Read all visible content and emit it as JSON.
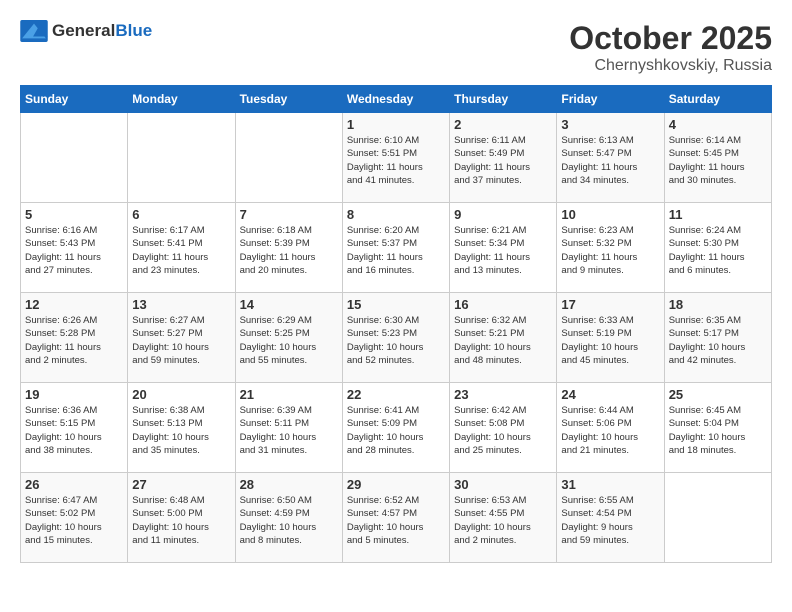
{
  "header": {
    "logo_general": "General",
    "logo_blue": "Blue",
    "month": "October 2025",
    "location": "Chernyshkovskiy, Russia"
  },
  "weekdays": [
    "Sunday",
    "Monday",
    "Tuesday",
    "Wednesday",
    "Thursday",
    "Friday",
    "Saturday"
  ],
  "weeks": [
    [
      {
        "day": "",
        "info": ""
      },
      {
        "day": "",
        "info": ""
      },
      {
        "day": "",
        "info": ""
      },
      {
        "day": "1",
        "info": "Sunrise: 6:10 AM\nSunset: 5:51 PM\nDaylight: 11 hours\nand 41 minutes."
      },
      {
        "day": "2",
        "info": "Sunrise: 6:11 AM\nSunset: 5:49 PM\nDaylight: 11 hours\nand 37 minutes."
      },
      {
        "day": "3",
        "info": "Sunrise: 6:13 AM\nSunset: 5:47 PM\nDaylight: 11 hours\nand 34 minutes."
      },
      {
        "day": "4",
        "info": "Sunrise: 6:14 AM\nSunset: 5:45 PM\nDaylight: 11 hours\nand 30 minutes."
      }
    ],
    [
      {
        "day": "5",
        "info": "Sunrise: 6:16 AM\nSunset: 5:43 PM\nDaylight: 11 hours\nand 27 minutes."
      },
      {
        "day": "6",
        "info": "Sunrise: 6:17 AM\nSunset: 5:41 PM\nDaylight: 11 hours\nand 23 minutes."
      },
      {
        "day": "7",
        "info": "Sunrise: 6:18 AM\nSunset: 5:39 PM\nDaylight: 11 hours\nand 20 minutes."
      },
      {
        "day": "8",
        "info": "Sunrise: 6:20 AM\nSunset: 5:37 PM\nDaylight: 11 hours\nand 16 minutes."
      },
      {
        "day": "9",
        "info": "Sunrise: 6:21 AM\nSunset: 5:34 PM\nDaylight: 11 hours\nand 13 minutes."
      },
      {
        "day": "10",
        "info": "Sunrise: 6:23 AM\nSunset: 5:32 PM\nDaylight: 11 hours\nand 9 minutes."
      },
      {
        "day": "11",
        "info": "Sunrise: 6:24 AM\nSunset: 5:30 PM\nDaylight: 11 hours\nand 6 minutes."
      }
    ],
    [
      {
        "day": "12",
        "info": "Sunrise: 6:26 AM\nSunset: 5:28 PM\nDaylight: 11 hours\nand 2 minutes."
      },
      {
        "day": "13",
        "info": "Sunrise: 6:27 AM\nSunset: 5:27 PM\nDaylight: 10 hours\nand 59 minutes."
      },
      {
        "day": "14",
        "info": "Sunrise: 6:29 AM\nSunset: 5:25 PM\nDaylight: 10 hours\nand 55 minutes."
      },
      {
        "day": "15",
        "info": "Sunrise: 6:30 AM\nSunset: 5:23 PM\nDaylight: 10 hours\nand 52 minutes."
      },
      {
        "day": "16",
        "info": "Sunrise: 6:32 AM\nSunset: 5:21 PM\nDaylight: 10 hours\nand 48 minutes."
      },
      {
        "day": "17",
        "info": "Sunrise: 6:33 AM\nSunset: 5:19 PM\nDaylight: 10 hours\nand 45 minutes."
      },
      {
        "day": "18",
        "info": "Sunrise: 6:35 AM\nSunset: 5:17 PM\nDaylight: 10 hours\nand 42 minutes."
      }
    ],
    [
      {
        "day": "19",
        "info": "Sunrise: 6:36 AM\nSunset: 5:15 PM\nDaylight: 10 hours\nand 38 minutes."
      },
      {
        "day": "20",
        "info": "Sunrise: 6:38 AM\nSunset: 5:13 PM\nDaylight: 10 hours\nand 35 minutes."
      },
      {
        "day": "21",
        "info": "Sunrise: 6:39 AM\nSunset: 5:11 PM\nDaylight: 10 hours\nand 31 minutes."
      },
      {
        "day": "22",
        "info": "Sunrise: 6:41 AM\nSunset: 5:09 PM\nDaylight: 10 hours\nand 28 minutes."
      },
      {
        "day": "23",
        "info": "Sunrise: 6:42 AM\nSunset: 5:08 PM\nDaylight: 10 hours\nand 25 minutes."
      },
      {
        "day": "24",
        "info": "Sunrise: 6:44 AM\nSunset: 5:06 PM\nDaylight: 10 hours\nand 21 minutes."
      },
      {
        "day": "25",
        "info": "Sunrise: 6:45 AM\nSunset: 5:04 PM\nDaylight: 10 hours\nand 18 minutes."
      }
    ],
    [
      {
        "day": "26",
        "info": "Sunrise: 6:47 AM\nSunset: 5:02 PM\nDaylight: 10 hours\nand 15 minutes."
      },
      {
        "day": "27",
        "info": "Sunrise: 6:48 AM\nSunset: 5:00 PM\nDaylight: 10 hours\nand 11 minutes."
      },
      {
        "day": "28",
        "info": "Sunrise: 6:50 AM\nSunset: 4:59 PM\nDaylight: 10 hours\nand 8 minutes."
      },
      {
        "day": "29",
        "info": "Sunrise: 6:52 AM\nSunset: 4:57 PM\nDaylight: 10 hours\nand 5 minutes."
      },
      {
        "day": "30",
        "info": "Sunrise: 6:53 AM\nSunset: 4:55 PM\nDaylight: 10 hours\nand 2 minutes."
      },
      {
        "day": "31",
        "info": "Sunrise: 6:55 AM\nSunset: 4:54 PM\nDaylight: 9 hours\nand 59 minutes."
      },
      {
        "day": "",
        "info": ""
      }
    ]
  ]
}
